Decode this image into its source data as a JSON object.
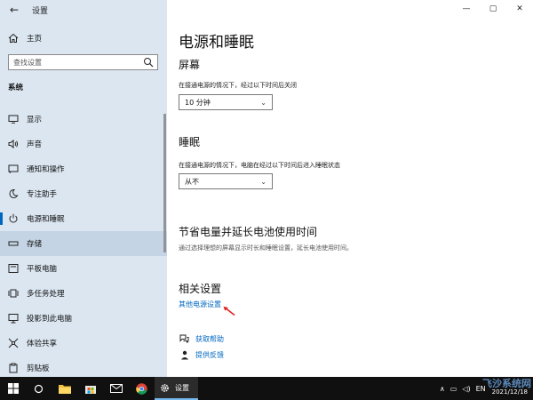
{
  "window": {
    "app_title": "设置",
    "controls": {
      "minimize": "—",
      "maximize": "▢",
      "close": "✕"
    }
  },
  "sidebar": {
    "home_label": "主页",
    "search_placeholder": "查找设置",
    "section_label": "系统",
    "items": [
      {
        "label": "显示",
        "icon": "monitor-icon"
      },
      {
        "label": "声音",
        "icon": "speaker-icon"
      },
      {
        "label": "通知和操作",
        "icon": "notification-icon"
      },
      {
        "label": "专注助手",
        "icon": "moon-icon"
      },
      {
        "label": "电源和睡眠",
        "icon": "power-icon",
        "active": true
      },
      {
        "label": "存储",
        "icon": "storage-icon",
        "hover": true
      },
      {
        "label": "平板电脑",
        "icon": "tablet-icon"
      },
      {
        "label": "多任务处理",
        "icon": "multitask-icon"
      },
      {
        "label": "投影到此电脑",
        "icon": "project-icon"
      },
      {
        "label": "体验共享",
        "icon": "shared-icon"
      },
      {
        "label": "剪贴板",
        "icon": "clipboard-icon"
      }
    ]
  },
  "main": {
    "title": "电源和睡眠",
    "screen": {
      "heading": "屏幕",
      "description": "在接通电源的情况下，经过以下时间后关闭",
      "value": "10 分钟"
    },
    "sleep": {
      "heading": "睡眠",
      "description": "在接通电源的情况下，电脑在经过以下时间后进入睡眠状态",
      "value": "从不"
    },
    "battery": {
      "heading": "节省电量并延长电池使用时间",
      "description": "通过选择理想的屏幕显示时长和睡眠设置，延长电池使用时间。"
    },
    "related": {
      "heading": "相关设置",
      "link": "其他电源设置"
    },
    "help": {
      "get_help": "获取帮助",
      "feedback": "提供反馈"
    }
  },
  "taskbar": {
    "settings_label": "设置",
    "tray_lang": "EN",
    "date": "2021/12/18",
    "watermark": "飞沙系统网"
  },
  "colors": {
    "sidebar_bg": "#dbe6f1",
    "accent": "#0067c0",
    "taskbar_bg": "#101010"
  }
}
